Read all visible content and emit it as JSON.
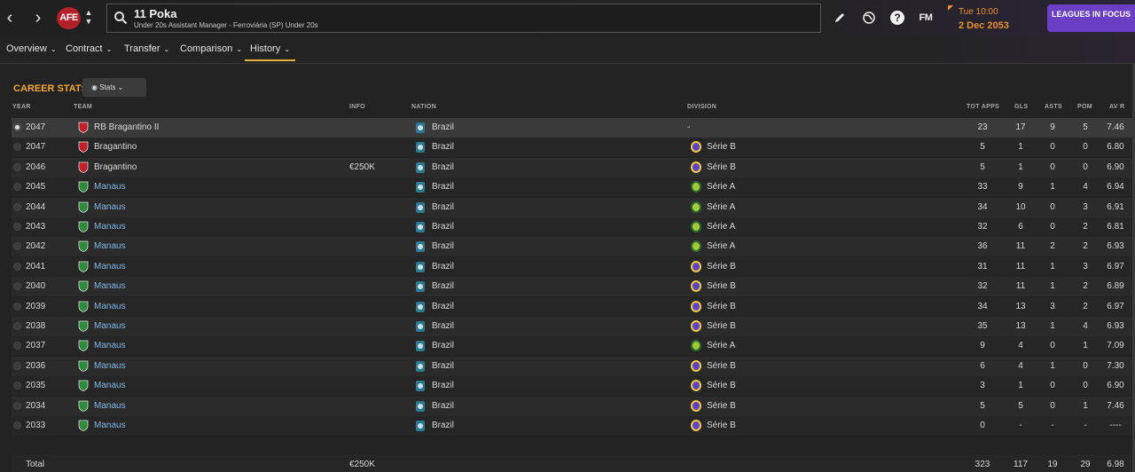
{
  "header": {
    "crest_text": "AFE",
    "player_title": "11 Poka",
    "player_subtitle": "Under 20s Assistant Manager - Ferroviária (SP) Under 20s",
    "fm_label": "FM",
    "help_label": "?",
    "date_day": "Tue 10:00",
    "date_full": "2 Dec 2053",
    "leagues_button": "LEAGUES IN FOCUS"
  },
  "tabs": [
    {
      "label": "Overview"
    },
    {
      "label": "Contract"
    },
    {
      "label": "Transfer"
    },
    {
      "label": "Comparison"
    },
    {
      "label": "History",
      "active": true
    }
  ],
  "section": {
    "title": "CAREER STATS",
    "stats_button": "Stats"
  },
  "columns": {
    "year": "YEAR",
    "team": "TEAM",
    "info": "INFO",
    "nation": "NATION",
    "division": "DIVISION",
    "apps": "TOT APPS",
    "gls": "GLS",
    "asts": "ASTS",
    "pom": "POM",
    "avr": "AV R"
  },
  "rows": [
    {
      "year": "2047",
      "team": "RB Bragantino II",
      "team_color": "#c0202a",
      "link": false,
      "info": "",
      "nation": "Brazil",
      "division": "-",
      "div_type": "none",
      "apps": "23",
      "gls": "17",
      "asts": "9",
      "pom": "5",
      "avr": "7.46"
    },
    {
      "year": "2047",
      "team": "Bragantino",
      "team_color": "#c0202a",
      "link": false,
      "info": "",
      "nation": "Brazil",
      "division": "Série B",
      "div_type": "b",
      "apps": "5",
      "gls": "1",
      "asts": "0",
      "pom": "0",
      "avr": "6.80"
    },
    {
      "year": "2046",
      "team": "Bragantino",
      "team_color": "#c0202a",
      "link": false,
      "info": "€250K",
      "nation": "Brazil",
      "division": "Série B",
      "div_type": "b",
      "apps": "5",
      "gls": "1",
      "asts": "0",
      "pom": "0",
      "avr": "6.90"
    },
    {
      "year": "2045",
      "team": "Manaus",
      "team_color": "#2e8b3c",
      "link": true,
      "info": "",
      "nation": "Brazil",
      "division": "Série A",
      "div_type": "a",
      "apps": "33",
      "gls": "9",
      "asts": "1",
      "pom": "4",
      "avr": "6.94"
    },
    {
      "year": "2044",
      "team": "Manaus",
      "team_color": "#2e8b3c",
      "link": true,
      "info": "",
      "nation": "Brazil",
      "division": "Série A",
      "div_type": "a",
      "apps": "34",
      "gls": "10",
      "asts": "0",
      "pom": "3",
      "avr": "6.91"
    },
    {
      "year": "2043",
      "team": "Manaus",
      "team_color": "#2e8b3c",
      "link": true,
      "info": "",
      "nation": "Brazil",
      "division": "Série A",
      "div_type": "a",
      "apps": "32",
      "gls": "6",
      "asts": "0",
      "pom": "2",
      "avr": "6.81"
    },
    {
      "year": "2042",
      "team": "Manaus",
      "team_color": "#2e8b3c",
      "link": true,
      "info": "",
      "nation": "Brazil",
      "division": "Série A",
      "div_type": "a",
      "apps": "36",
      "gls": "11",
      "asts": "2",
      "pom": "2",
      "avr": "6.93"
    },
    {
      "year": "2041",
      "team": "Manaus",
      "team_color": "#2e8b3c",
      "link": true,
      "info": "",
      "nation": "Brazil",
      "division": "Série B",
      "div_type": "b",
      "apps": "31",
      "gls": "11",
      "asts": "1",
      "pom": "3",
      "avr": "6.97"
    },
    {
      "year": "2040",
      "team": "Manaus",
      "team_color": "#2e8b3c",
      "link": true,
      "info": "",
      "nation": "Brazil",
      "division": "Série B",
      "div_type": "b",
      "apps": "32",
      "gls": "11",
      "asts": "1",
      "pom": "2",
      "avr": "6.89"
    },
    {
      "year": "2039",
      "team": "Manaus",
      "team_color": "#2e8b3c",
      "link": true,
      "info": "",
      "nation": "Brazil",
      "division": "Série B",
      "div_type": "b",
      "apps": "34",
      "gls": "13",
      "asts": "3",
      "pom": "2",
      "avr": "6.97"
    },
    {
      "year": "2038",
      "team": "Manaus",
      "team_color": "#2e8b3c",
      "link": true,
      "info": "",
      "nation": "Brazil",
      "division": "Série B",
      "div_type": "b",
      "apps": "35",
      "gls": "13",
      "asts": "1",
      "pom": "4",
      "avr": "6.93"
    },
    {
      "year": "2037",
      "team": "Manaus",
      "team_color": "#2e8b3c",
      "link": true,
      "info": "",
      "nation": "Brazil",
      "division": "Série A",
      "div_type": "a",
      "apps": "9",
      "gls": "4",
      "asts": "0",
      "pom": "1",
      "avr": "7.09"
    },
    {
      "year": "2036",
      "team": "Manaus",
      "team_color": "#2e8b3c",
      "link": true,
      "info": "",
      "nation": "Brazil",
      "division": "Série B",
      "div_type": "b",
      "apps": "6",
      "gls": "4",
      "asts": "1",
      "pom": "0",
      "avr": "7.30"
    },
    {
      "year": "2035",
      "team": "Manaus",
      "team_color": "#2e8b3c",
      "link": true,
      "info": "",
      "nation": "Brazil",
      "division": "Série B",
      "div_type": "b",
      "apps": "3",
      "gls": "1",
      "asts": "0",
      "pom": "0",
      "avr": "6.90"
    },
    {
      "year": "2034",
      "team": "Manaus",
      "team_color": "#2e8b3c",
      "link": true,
      "info": "",
      "nation": "Brazil",
      "division": "Série B",
      "div_type": "b",
      "apps": "5",
      "gls": "5",
      "asts": "0",
      "pom": "1",
      "avr": "7.46"
    },
    {
      "year": "2033",
      "team": "Manaus",
      "team_color": "#2e8b3c",
      "link": true,
      "info": "",
      "nation": "Brazil",
      "division": "Série B",
      "div_type": "b",
      "apps": "0",
      "gls": "-",
      "asts": "-",
      "pom": "-",
      "avr": "----"
    }
  ],
  "total": {
    "label": "Total",
    "info": "€250K",
    "apps": "323",
    "gls": "117",
    "asts": "19",
    "pom": "29",
    "avr": "6.98"
  }
}
